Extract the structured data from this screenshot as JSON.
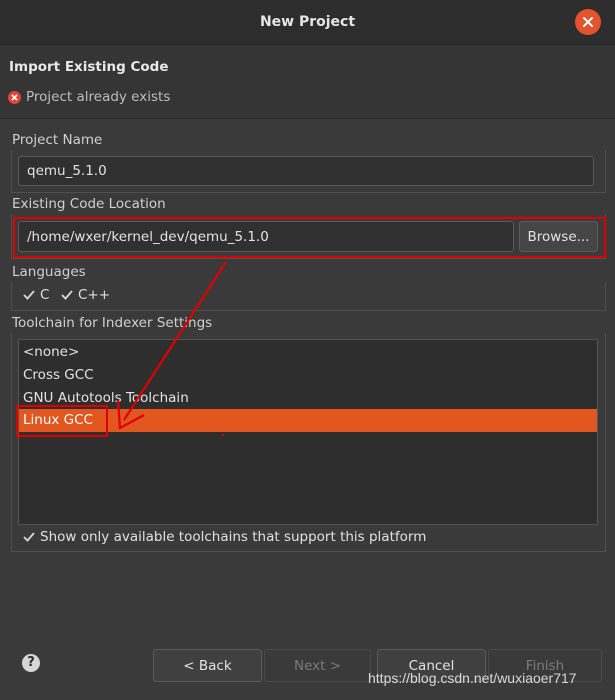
{
  "window": {
    "title": "New Project"
  },
  "header": {
    "heading": "Import Existing Code",
    "error": "Project already exists"
  },
  "project_name": {
    "label": "Project Name",
    "value": "qemu_5.1.0"
  },
  "location": {
    "label": "Existing Code Location",
    "value": "/home/wxer/kernel_dev/qemu_5.1.0",
    "browse_label": "Browse..."
  },
  "languages": {
    "label": "Languages",
    "items": [
      {
        "label": "C",
        "checked": true
      },
      {
        "label": "C++",
        "checked": true
      }
    ]
  },
  "toolchain": {
    "label": "Toolchain for Indexer Settings",
    "items": [
      "<none>",
      "Cross GCC",
      "GNU Autotools Toolchain",
      "Linux GCC"
    ],
    "selected": "Linux GCC",
    "filter_label": "Show only available toolchains that support this platform",
    "filter_checked": true
  },
  "footer": {
    "back": "< Back",
    "next": "Next >",
    "cancel": "Cancel",
    "finish": "Finish"
  },
  "watermark": "https://blog.csdn.net/wuxiaoer717",
  "colors": {
    "accent": "#e2561f",
    "annotation": "#e00000"
  }
}
